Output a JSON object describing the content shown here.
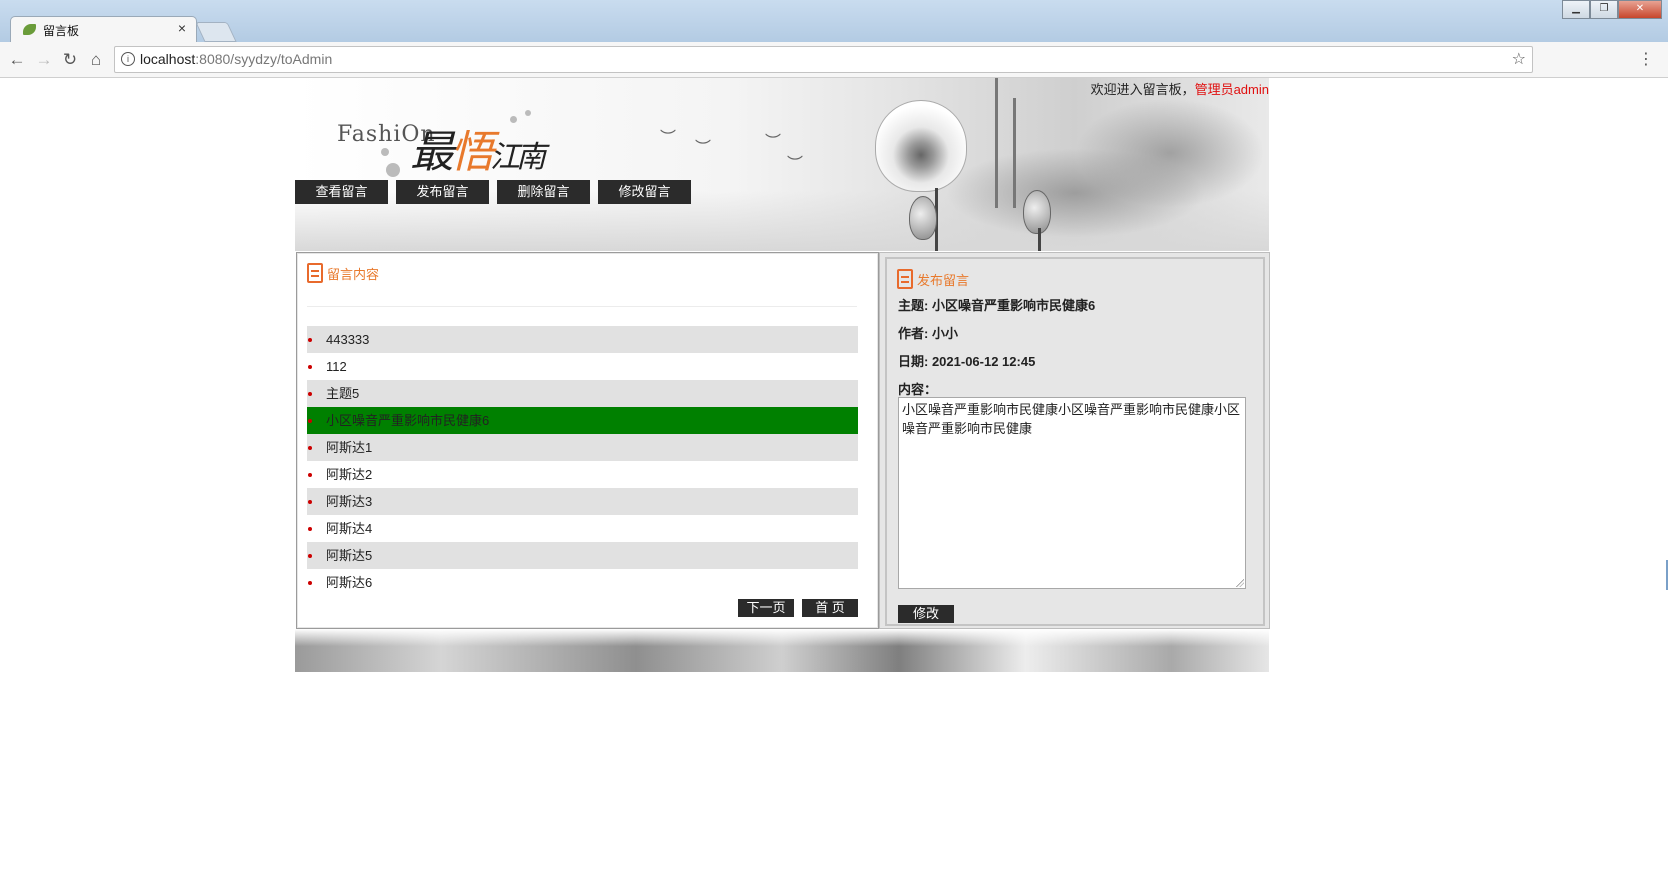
{
  "browser": {
    "tab_title": "留言板",
    "tab_close": "×",
    "url_host": "localhost",
    "url_rest": ":8080/syydzy/toAdmin",
    "back_icon": "back-arrow-icon",
    "forward_icon": "forward-arrow-icon",
    "reload_icon": "reload-icon",
    "home_icon": "home-icon",
    "star_icon": "star-icon",
    "menu_icon": "menu-icon"
  },
  "header": {
    "welcome_text": "欢迎进入留言板，",
    "admin_text": "管理员admin",
    "logo_en": "FashiOn",
    "logo_cn_1": "最",
    "logo_cn_2": "悟",
    "logo_cn_3": "江南"
  },
  "nav": {
    "items": [
      {
        "label": "查看留言"
      },
      {
        "label": "发布留言"
      },
      {
        "label": "删除留言"
      },
      {
        "label": "修改留言"
      }
    ]
  },
  "list_panel": {
    "title": "留言内容",
    "items": [
      {
        "label": "443333"
      },
      {
        "label": "112"
      },
      {
        "label": "主题5"
      },
      {
        "label": "小区噪音严重影响市民健康6"
      },
      {
        "label": "阿斯达1"
      },
      {
        "label": "阿斯达2"
      },
      {
        "label": "阿斯达3"
      },
      {
        "label": "阿斯达4"
      },
      {
        "label": "阿斯达5"
      },
      {
        "label": "阿斯达6"
      }
    ],
    "selected_index": 3,
    "next_page": "下一页",
    "first_page": "首 页"
  },
  "detail_panel": {
    "title": "发布留言",
    "subject": "主题: 小区噪音严重影响市民健康6",
    "author": "作者: 小小",
    "date": "日期: 2021-06-12 12:45",
    "content_label": "内容：",
    "content": "小区噪音严重影响市民健康小区噪音严重影响市民健康小区噪音严重影响市民健康",
    "edit_button": "修改"
  },
  "colors": {
    "accent_orange": "#e8792c",
    "admin_red": "#e01010",
    "selected_green": "#008000",
    "button_dark": "#2b2b2b"
  }
}
